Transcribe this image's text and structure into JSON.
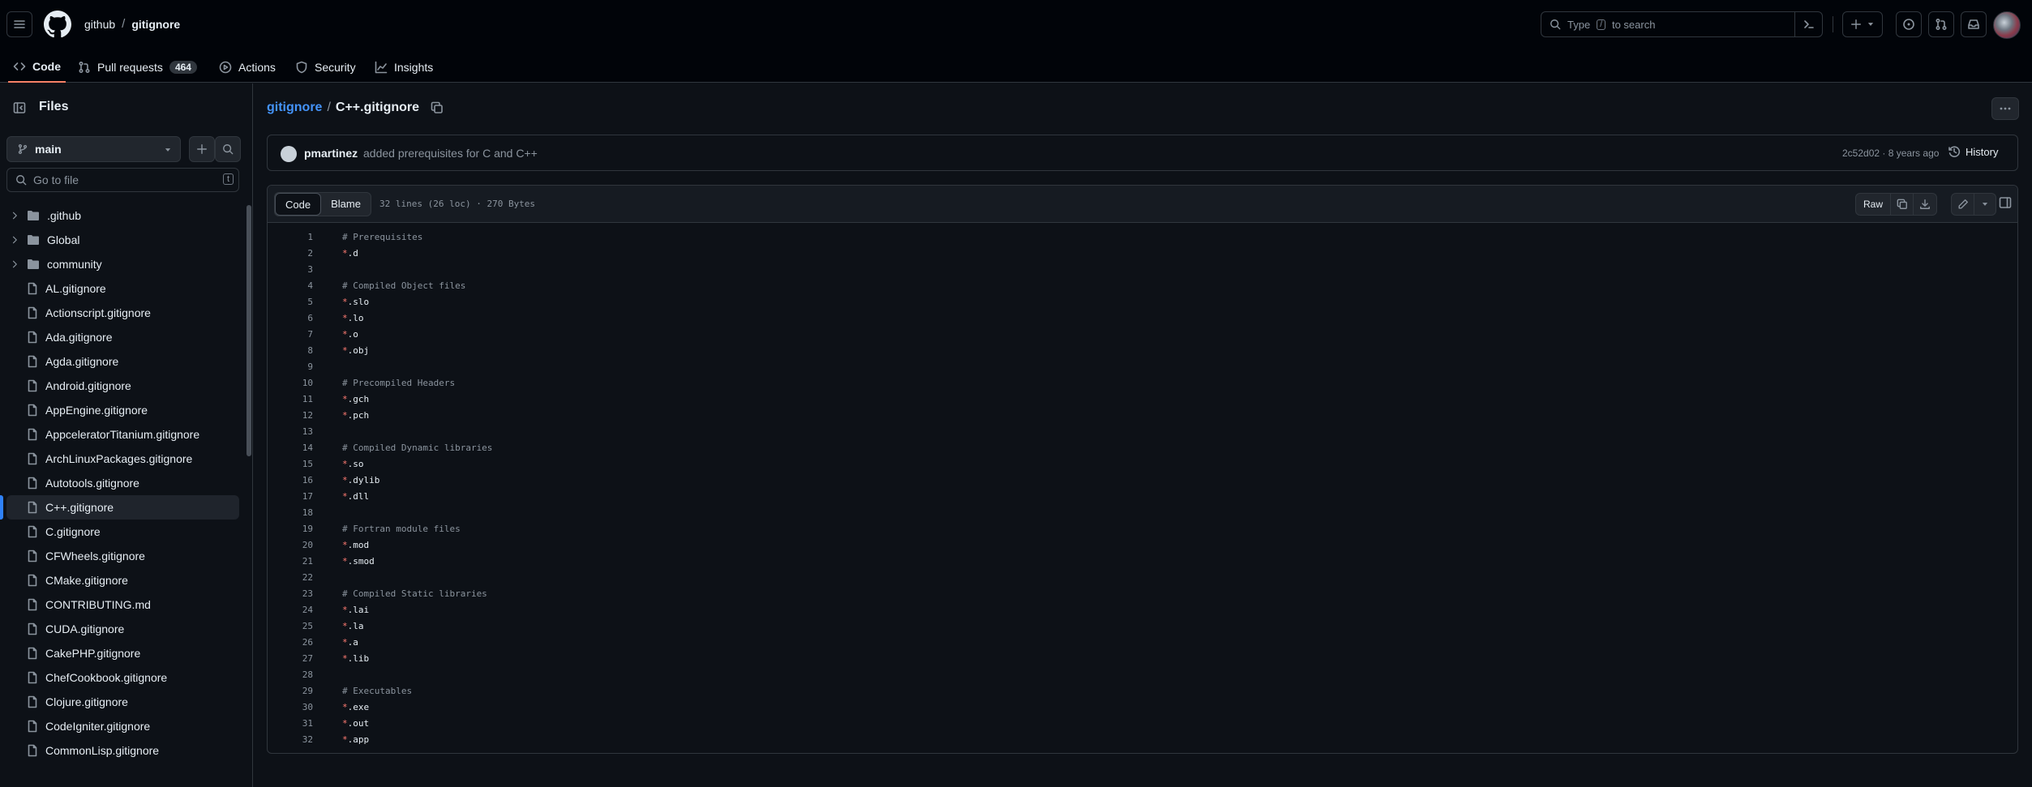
{
  "header": {
    "owner": "github",
    "separator": "/",
    "repo": "gitignore",
    "search_prefix": "Type",
    "search_key": "/",
    "search_suffix": "to search"
  },
  "repo_nav": {
    "tabs": [
      {
        "label": "Code"
      },
      {
        "label": "Pull requests",
        "count": "464"
      },
      {
        "label": "Actions"
      },
      {
        "label": "Security"
      },
      {
        "label": "Insights"
      }
    ]
  },
  "sidebar": {
    "title": "Files",
    "branch": "main",
    "filter_placeholder": "Go to file",
    "filter_shortcut": "t",
    "folders": [
      ".github",
      "Global",
      "community"
    ],
    "files": [
      "AL.gitignore",
      "Actionscript.gitignore",
      "Ada.gitignore",
      "Agda.gitignore",
      "Android.gitignore",
      "AppEngine.gitignore",
      "AppceleratorTitanium.gitignore",
      "ArchLinuxPackages.gitignore",
      "Autotools.gitignore",
      "C++.gitignore",
      "C.gitignore",
      "CFWheels.gitignore",
      "CMake.gitignore",
      "CONTRIBUTING.md",
      "CUDA.gitignore",
      "CakePHP.gitignore",
      "ChefCookbook.gitignore",
      "Clojure.gitignore",
      "CodeIgniter.gitignore",
      "CommonLisp.gitignore"
    ],
    "selected_file": "C++.gitignore"
  },
  "breadcrumb": {
    "repo": "gitignore",
    "separator": "/",
    "file": "C++.gitignore"
  },
  "commit": {
    "author": "pmartinez",
    "message": "added prerequisites for C and C++",
    "meta": "2c52d02 · 8 years ago",
    "history_label": "History"
  },
  "file_header": {
    "code_tab": "Code",
    "blame_tab": "Blame",
    "info": "32 lines (26 loc) · 270 Bytes",
    "raw_label": "Raw"
  },
  "code_lines": [
    {
      "n": "1",
      "text": "# Prerequisites"
    },
    {
      "n": "2",
      "text": "*.d"
    },
    {
      "n": "3",
      "text": ""
    },
    {
      "n": "4",
      "text": "# Compiled Object files"
    },
    {
      "n": "5",
      "text": "*.slo"
    },
    {
      "n": "6",
      "text": "*.lo"
    },
    {
      "n": "7",
      "text": "*.o"
    },
    {
      "n": "8",
      "text": "*.obj"
    },
    {
      "n": "9",
      "text": ""
    },
    {
      "n": "10",
      "text": "# Precompiled Headers"
    },
    {
      "n": "11",
      "text": "*.gch"
    },
    {
      "n": "12",
      "text": "*.pch"
    },
    {
      "n": "13",
      "text": ""
    },
    {
      "n": "14",
      "text": "# Compiled Dynamic libraries"
    },
    {
      "n": "15",
      "text": "*.so"
    },
    {
      "n": "16",
      "text": "*.dylib"
    },
    {
      "n": "17",
      "text": "*.dll"
    },
    {
      "n": "18",
      "text": ""
    },
    {
      "n": "19",
      "text": "# Fortran module files"
    },
    {
      "n": "20",
      "text": "*.mod"
    },
    {
      "n": "21",
      "text": "*.smod"
    },
    {
      "n": "22",
      "text": ""
    },
    {
      "n": "23",
      "text": "# Compiled Static libraries"
    },
    {
      "n": "24",
      "text": "*.lai"
    },
    {
      "n": "25",
      "text": "*.la"
    },
    {
      "n": "26",
      "text": "*.a"
    },
    {
      "n": "27",
      "text": "*.lib"
    },
    {
      "n": "28",
      "text": ""
    },
    {
      "n": "29",
      "text": "# Executables"
    },
    {
      "n": "30",
      "text": "*.exe"
    },
    {
      "n": "31",
      "text": "*.out"
    },
    {
      "n": "32",
      "text": "*.app"
    }
  ],
  "colors": {
    "background": "#0d1117",
    "header_bg": "#010409",
    "link": "#4493f8",
    "active_tab_underline": "#f78166",
    "selected_accent": "#2f81f7",
    "code_star": "#ff7b72"
  }
}
